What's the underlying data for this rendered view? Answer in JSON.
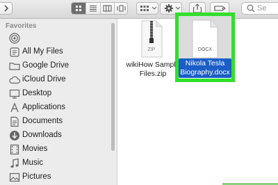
{
  "toolbar": {
    "search_placeholder": "Se"
  },
  "sidebar": {
    "section_title": "Favorites",
    "items": [
      {
        "label": "",
        "icon": "airdrop-icon"
      },
      {
        "label": "All My Files",
        "icon": "all-files-icon"
      },
      {
        "label": "Google Drive",
        "icon": "folder-icon"
      },
      {
        "label": "iCloud Drive",
        "icon": "cloud-icon"
      },
      {
        "label": "Desktop",
        "icon": "desktop-icon"
      },
      {
        "label": "Applications",
        "icon": "applications-icon"
      },
      {
        "label": "Documents",
        "icon": "documents-icon"
      },
      {
        "label": "Downloads",
        "icon": "downloads-icon"
      },
      {
        "label": "Movies",
        "icon": "movies-icon"
      },
      {
        "label": "Music",
        "icon": "music-icon"
      },
      {
        "label": "Pictures",
        "icon": "pictures-icon"
      }
    ]
  },
  "files": [
    {
      "name_line1": "wikiHow Sample",
      "name_line2": "Files.zip",
      "badge": "ZIP",
      "icon": "zip-file-icon"
    },
    {
      "name_line1": "Nikola Tesla",
      "name_line2": "Biography.docx",
      "badge": "DOCX",
      "icon": "docx-file-icon",
      "selected": true
    }
  ],
  "colors": {
    "selection_blue": "#1b5ec8",
    "highlight_green": "#2fe02a"
  }
}
